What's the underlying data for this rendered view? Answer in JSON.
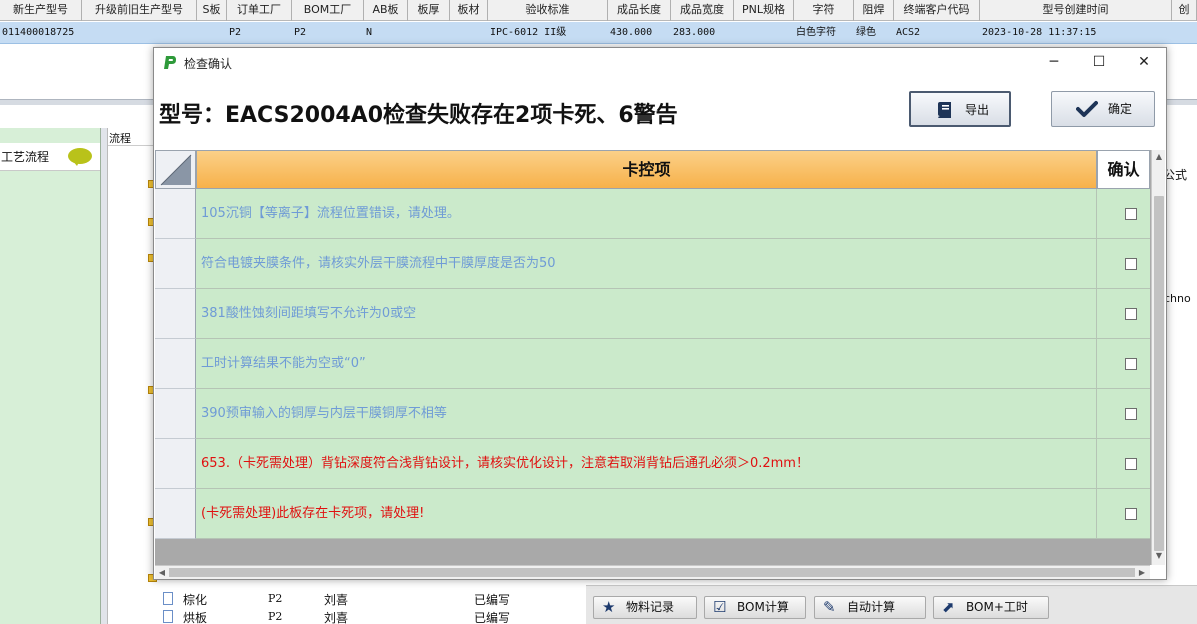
{
  "background": {
    "columns": [
      "新生产型号",
      "升级前旧生产型号",
      "S板",
      "订单工厂",
      "BOM工厂",
      "AB板",
      "板厚",
      "板材",
      "验收标准",
      "成品长度",
      "成品宽度",
      "PNL规格",
      "字符",
      "阻焊",
      "终端客户代码",
      "型号创建时间",
      "创"
    ],
    "row": {
      "c0": "011400018725",
      "c3": "P2",
      "c4": "P2",
      "c5": "N",
      "c8": "IPC-6012 II级",
      "c9": "430.000",
      "c10": "283.000",
      "c12": "白色字符",
      "c13": "绿色",
      "c14": "ACS2",
      "c15": "2023-10-28 11:37:15"
    },
    "left_panel_title": "工艺流程",
    "tree_header": "流程",
    "tree_rows": [
      {
        "name": "棕化",
        "plant": "P2",
        "person": "刘喜",
        "status": "已编写"
      },
      {
        "name": "烘板",
        "plant": "P2",
        "person": "刘喜",
        "status": "已编写"
      }
    ],
    "right_gongshi": "公式",
    "right_techno": "chno",
    "bottom_buttons": [
      {
        "label": "物料记录",
        "icon": "star-icon"
      },
      {
        "label": "BOM计算",
        "icon": "check-icon"
      },
      {
        "label": "自动计算",
        "icon": "pencil-icon"
      },
      {
        "label": "BOM+工时",
        "icon": "arrow-up-right-icon"
      }
    ]
  },
  "dialog": {
    "title": "检查确认",
    "heading": "型号：EACS2004A0检查失败存在2项卡死、6警告",
    "export_label": "导出",
    "confirm_label": "确定",
    "grid": {
      "col_main": "卡控项",
      "col_confirm": "确认",
      "rows": [
        {
          "text": "105沉铜【等离子】流程位置错误，请处理。",
          "level": "warn"
        },
        {
          "text": "符合电镀夹膜条件，请核实外层干膜流程中干膜厚度是否为50",
          "level": "warn"
        },
        {
          "text": "381酸性蚀刻间距填写不允许为0或空",
          "level": "warn"
        },
        {
          "text": "工时计算结果不能为空或“0”",
          "level": "warn"
        },
        {
          "text": "390预审输入的铜厚与内层干膜铜厚不相等",
          "level": "warn"
        },
        {
          "text": "653.（卡死需处理）背钻深度符合浅背钻设计，请核实优化设计，注意若取消背钻后通孔必须＞0.2mm！",
          "level": "error"
        },
        {
          "text": "(卡死需处理)此板存在卡死项，请处理!",
          "level": "error"
        }
      ]
    }
  },
  "colors": {
    "row_green": "#cbeacb",
    "header_orange": "#f7b14a",
    "warn_text": "#6f9bd6",
    "error_text": "#e01010",
    "selected_row": "#c5dcf3"
  }
}
